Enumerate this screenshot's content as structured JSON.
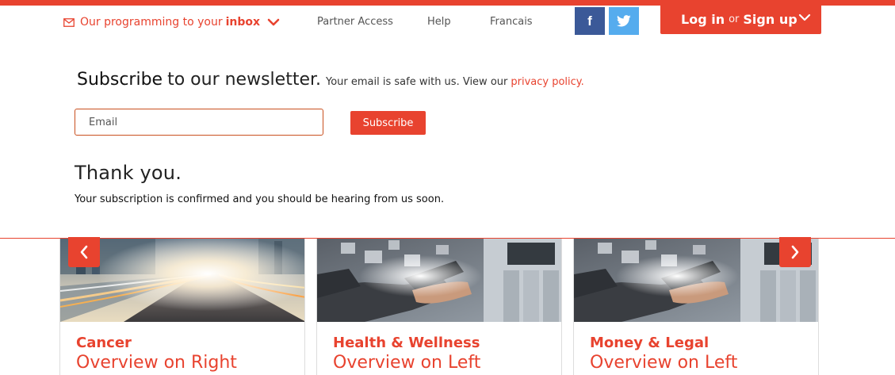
{
  "header": {
    "inbox_prefix": "Our programming to your",
    "inbox_bold": "inbox",
    "nav": [
      {
        "label": "Partner Access"
      },
      {
        "label": "Help"
      },
      {
        "label": "Francais"
      }
    ],
    "social": {
      "facebook": "f"
    },
    "login": {
      "login": "Log in",
      "or": "or",
      "signup": "Sign up"
    }
  },
  "newsletter": {
    "title_word": "Subscribe",
    "title_rest": "to our newsletter.",
    "note": "Your email is safe with us. View our",
    "privacy_link": "privacy policy.",
    "email_placeholder": "Email",
    "button": "Subscribe",
    "thanks_title": "Thank you.",
    "thanks_text": "Your subscription is confirmed and you should be hearing from us soon."
  },
  "cards": [
    {
      "category": "Cancer",
      "overview": "Overview on Right"
    },
    {
      "category": "Health & Wellness",
      "overview": "Overview on Left"
    },
    {
      "category": "Money & Legal",
      "overview": "Overview on Left"
    }
  ],
  "colors": {
    "accent": "#e8432f",
    "facebook": "#3b5998",
    "twitter": "#55acee"
  },
  "icons": [
    "mail-icon",
    "chevron-down-icon",
    "facebook-icon",
    "twitter-icon",
    "chevron-left-icon",
    "chevron-right-icon"
  ]
}
